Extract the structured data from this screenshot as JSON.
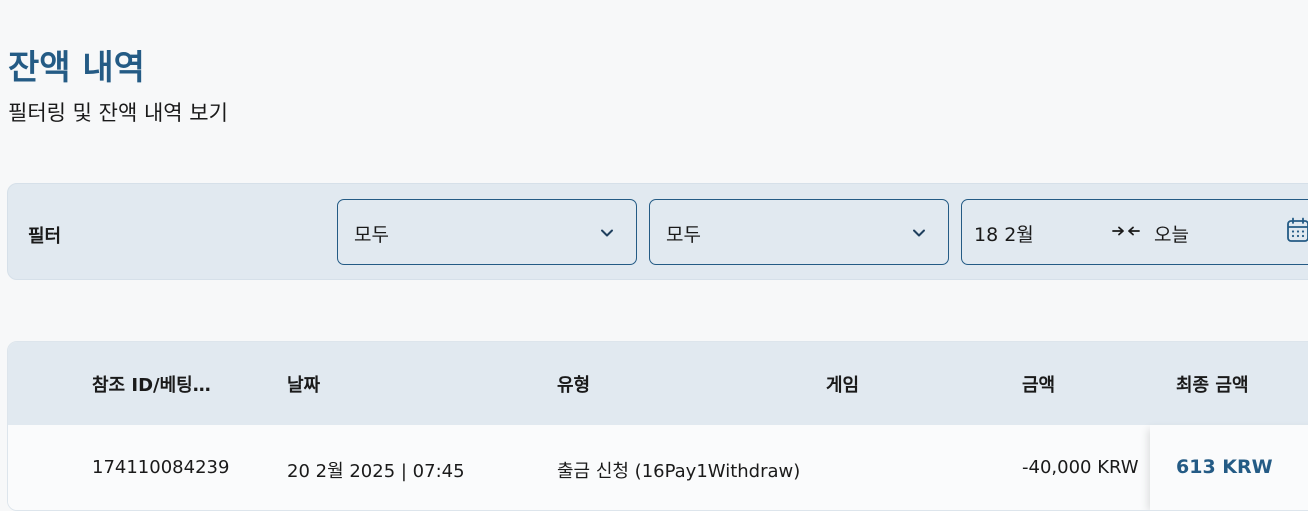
{
  "header": {
    "title": "잔액 내역",
    "subtitle": "필터링 및 잔액 내역 보기"
  },
  "filters": {
    "label": "필터",
    "type_select": {
      "value": "모두"
    },
    "game_select": {
      "value": "모두"
    },
    "date_range": {
      "from": "18 2월",
      "to": "오늘"
    }
  },
  "table": {
    "columns": [
      "참조 ID/베팅…",
      "날짜",
      "유형",
      "게임",
      "금액",
      "최종 금액"
    ],
    "rows": [
      {
        "ref_id": "174110084239",
        "date": "20 2월 2025 | 07:45",
        "type": "출금 신청 (16Pay1Withdraw)",
        "game": "",
        "amount": "-40,000 KRW",
        "final_amount": "613 KRW"
      }
    ]
  },
  "colors": {
    "accent": "#245b85",
    "panel": "#e1e9f0",
    "background": "#f7f8f9"
  },
  "icons": {
    "chevron": "chevron-down-icon",
    "arrows": "arrows-inward-icon",
    "calendar": "calendar-icon"
  }
}
